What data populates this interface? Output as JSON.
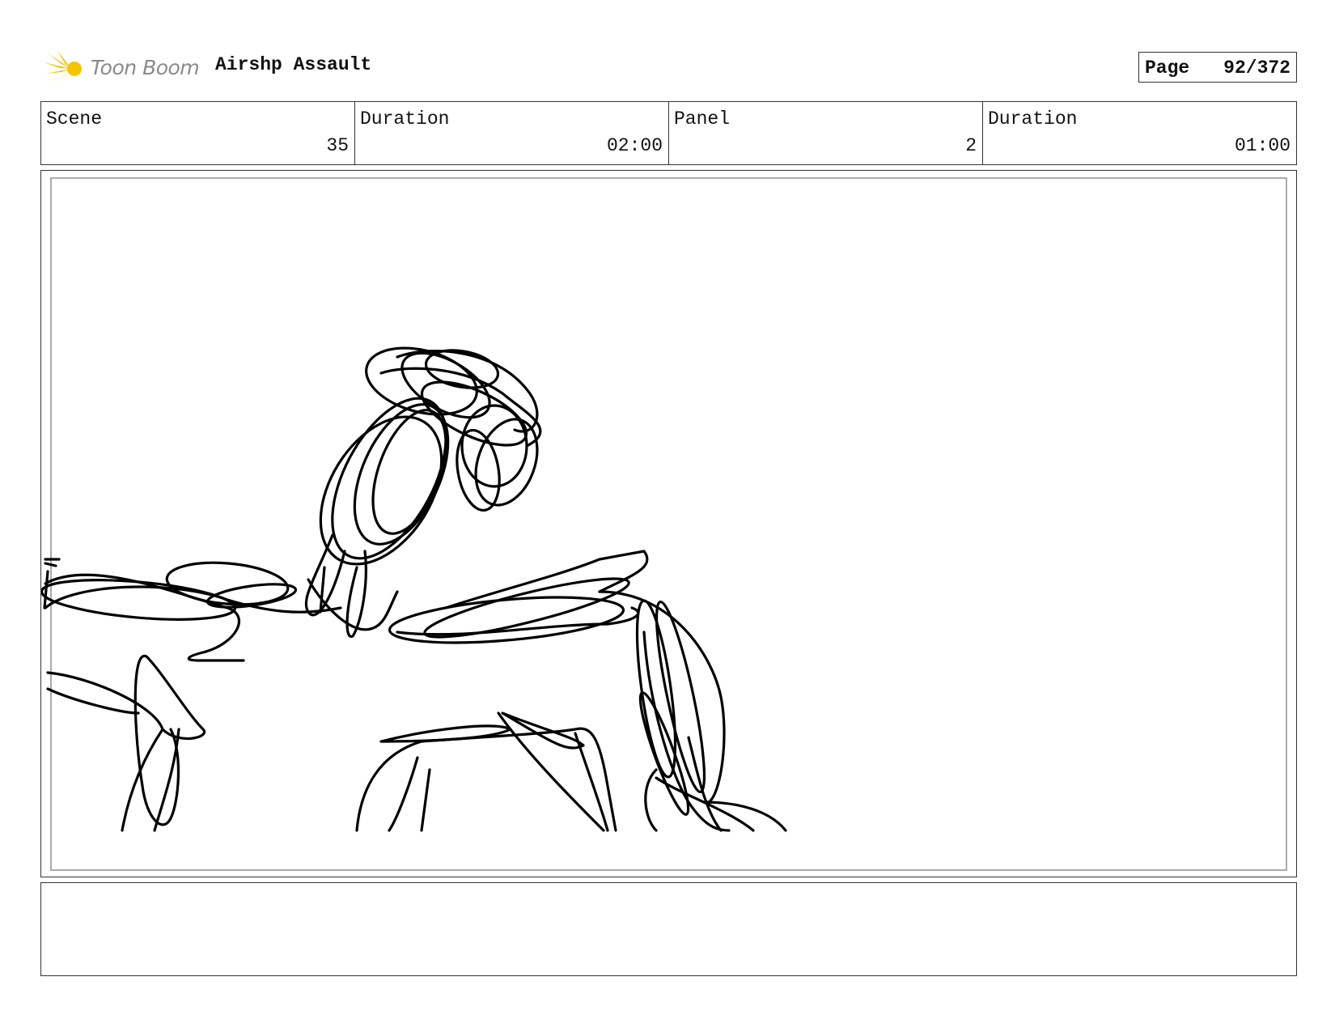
{
  "header": {
    "logo_text": "Toon Boom",
    "project_title": "Airshp Assault",
    "page_label": "Page",
    "page_value": "92/372"
  },
  "info": {
    "scene_label": "Scene",
    "scene_value": "35",
    "scene_duration_label": "Duration",
    "scene_duration_value": "02:00",
    "panel_label": "Panel",
    "panel_value": "2",
    "panel_duration_label": "Duration",
    "panel_duration_value": "01:00"
  },
  "colors": {
    "logo_yellow": "#f5c400",
    "logo_text": "#8a8a8a",
    "sketch_stroke": "#000000",
    "safe_frame": "#aaaaaa"
  },
  "notes": ""
}
